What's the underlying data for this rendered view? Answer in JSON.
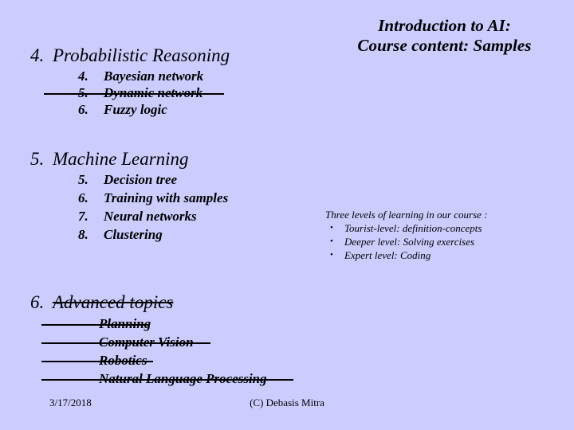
{
  "slide": {
    "background_color": "#ccccff",
    "text_color": "#000000"
  },
  "title": {
    "line1": "Introduction to AI:",
    "line2": "Course content: Samples"
  },
  "outline": [
    {
      "number": "4.",
      "text": "Probabilistic Reasoning",
      "struck": false,
      "children": [
        {
          "number": "4.",
          "text": "Bayesian network",
          "struck": false
        },
        {
          "number": "5.",
          "text": "Dynamic network",
          "struck": true
        },
        {
          "number": "6.",
          "text": "Fuzzy logic",
          "struck": false
        }
      ]
    },
    {
      "number": "5.",
      "text": "Machine Learning",
      "struck": false,
      "children": [
        {
          "number": "5.",
          "text": "Decision tree",
          "struck": false
        },
        {
          "number": "6.",
          "text": "Training with samples",
          "struck": false
        },
        {
          "number": "7.",
          "text": "Neural networks",
          "struck": false
        },
        {
          "number": "8.",
          "text": "Clustering",
          "struck": false
        }
      ]
    },
    {
      "number": "6.",
      "text": "Advanced topics",
      "struck": true,
      "children": [
        {
          "number": "",
          "text": "Planning",
          "struck": true
        },
        {
          "number": "",
          "text": "Computer Vision",
          "struck": true
        },
        {
          "number": "",
          "text": "Robotics",
          "struck": true
        },
        {
          "number": "",
          "text": "Natural Language Processing",
          "struck": true
        }
      ]
    }
  ],
  "note": {
    "heading": "Three levels of learning in our course :",
    "bullet_glyph": "•",
    "items": [
      "Tourist-level: definition-concepts",
      "Deeper level: Solving exercises",
      "Expert level: Coding"
    ]
  },
  "footer": {
    "date": "3/17/2018",
    "copyright": "(C) Debasis Mitra"
  }
}
